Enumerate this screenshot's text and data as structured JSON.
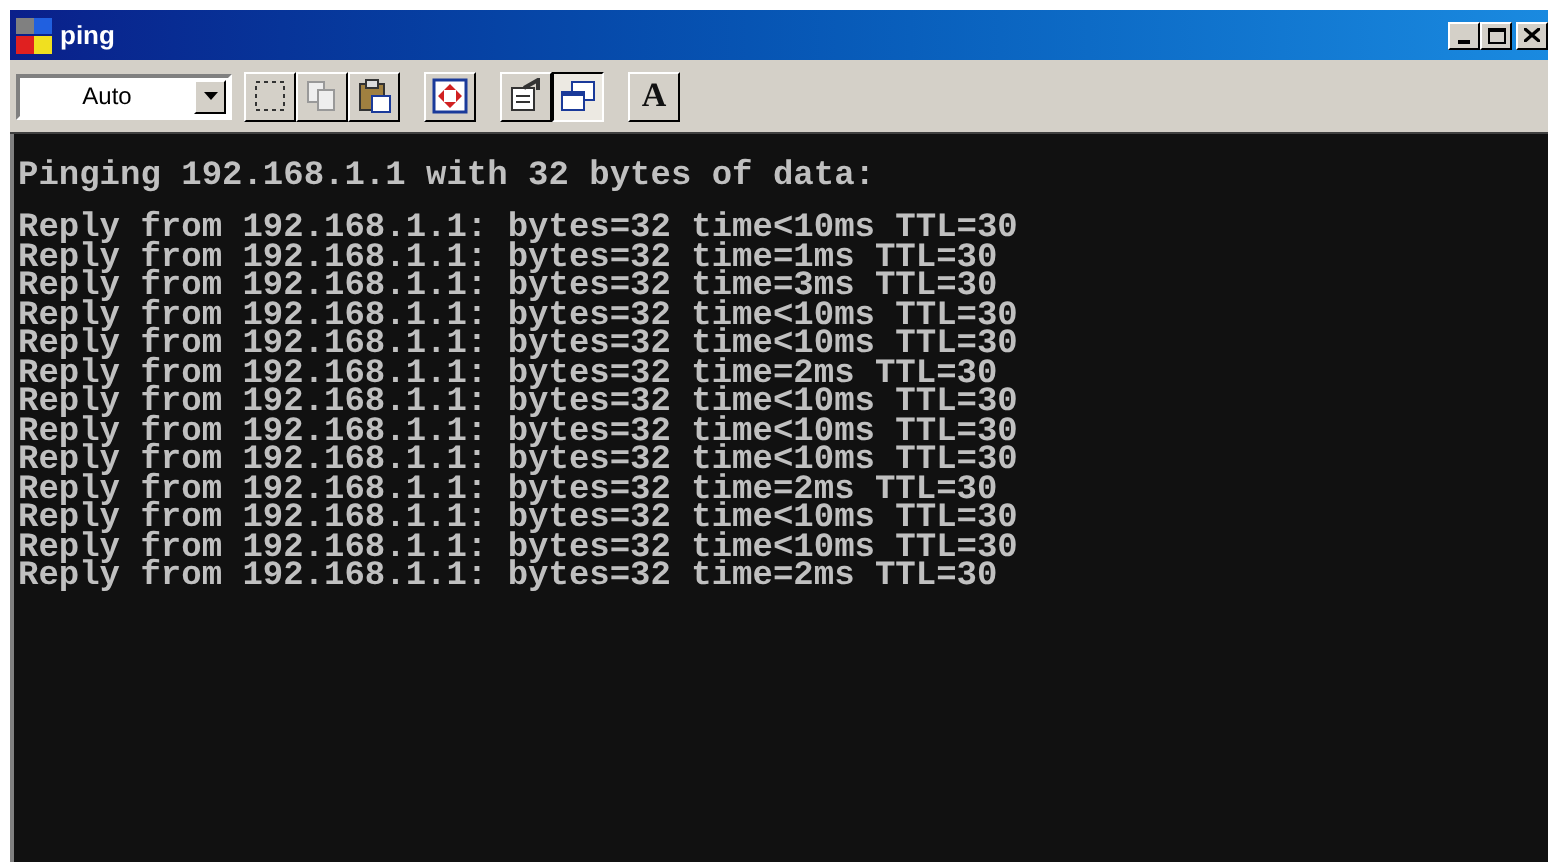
{
  "window": {
    "title": "ping"
  },
  "toolbar": {
    "font_size": "Auto",
    "tools": [
      {
        "kind": "mark",
        "pressed": false
      },
      {
        "kind": "copy",
        "pressed": false
      },
      {
        "kind": "paste",
        "pressed": false
      },
      {
        "kind": "separator"
      },
      {
        "kind": "fullscreen",
        "pressed": false
      },
      {
        "kind": "separator"
      },
      {
        "kind": "properties",
        "pressed": false
      },
      {
        "kind": "background",
        "pressed": true
      },
      {
        "kind": "separator"
      },
      {
        "kind": "font",
        "pressed": false,
        "label": "A"
      }
    ]
  },
  "console": {
    "header": "Pinging 192.168.1.1 with 32 bytes of data:",
    "lines": [
      "Reply from 192.168.1.1: bytes=32 time<10ms TTL=30",
      "Reply from 192.168.1.1: bytes=32 time=1ms TTL=30",
      "Reply from 192.168.1.1: bytes=32 time=3ms TTL=30",
      "Reply from 192.168.1.1: bytes=32 time<10ms TTL=30",
      "Reply from 192.168.1.1: bytes=32 time<10ms TTL=30",
      "Reply from 192.168.1.1: bytes=32 time=2ms TTL=30",
      "Reply from 192.168.1.1: bytes=32 time<10ms TTL=30",
      "Reply from 192.168.1.1: bytes=32 time<10ms TTL=30",
      "Reply from 192.168.1.1: bytes=32 time<10ms TTL=30",
      "Reply from 192.168.1.1: bytes=32 time=2ms TTL=30",
      "Reply from 192.168.1.1: bytes=32 time<10ms TTL=30",
      "Reply from 192.168.1.1: bytes=32 time<10ms TTL=30",
      "Reply from 192.168.1.1: bytes=32 time=2ms TTL=30"
    ]
  }
}
